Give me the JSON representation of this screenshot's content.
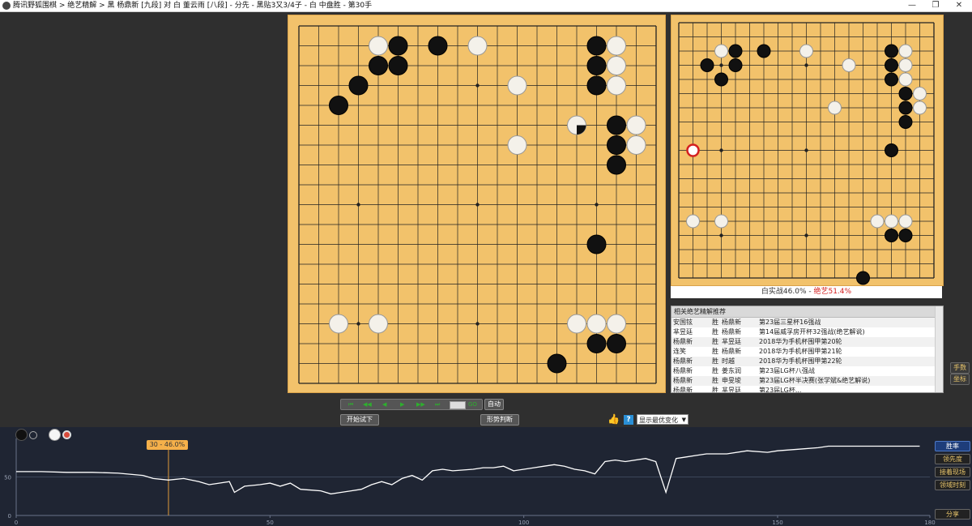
{
  "window": {
    "title": "腾讯野狐围棋 > 绝艺精解 > 黑 杨鼎新 [九段] 对 白 董云雨 [八段] - 分先 - 黑贴3又3/4子 - 白 中盘胜 - 第30手",
    "minimize": "—",
    "maximize": "❐",
    "close": "✕"
  },
  "main_board": {
    "size": 19,
    "black": [
      [
        4,
        2
      ],
      [
        5,
        1
      ],
      [
        5,
        2
      ],
      [
        7,
        1
      ],
      [
        3,
        3
      ],
      [
        2,
        4
      ],
      [
        15,
        1
      ],
      [
        15,
        2
      ],
      [
        15,
        3
      ],
      [
        16,
        5
      ],
      [
        16,
        6
      ],
      [
        16,
        7
      ],
      [
        15,
        11
      ],
      [
        15,
        16
      ],
      [
        16,
        16
      ],
      [
        13,
        17
      ]
    ],
    "white": [
      [
        4,
        1
      ],
      [
        9,
        1
      ],
      [
        11,
        3
      ],
      [
        16,
        1
      ],
      [
        16,
        2
      ],
      [
        16,
        3
      ],
      [
        17,
        5
      ],
      [
        17,
        6
      ],
      [
        11,
        6
      ],
      [
        2,
        15
      ],
      [
        4,
        15
      ],
      [
        14,
        15
      ],
      [
        15,
        15
      ],
      [
        16,
        15
      ]
    ],
    "last_move": [
      14,
      5
    ]
  },
  "side_board": {
    "size": 19,
    "black": [
      [
        2,
        3
      ],
      [
        3,
        4
      ],
      [
        4,
        2
      ],
      [
        4,
        3
      ],
      [
        6,
        2
      ],
      [
        13,
        18
      ],
      [
        15,
        2
      ],
      [
        15,
        3
      ],
      [
        15,
        4
      ],
      [
        16,
        5
      ],
      [
        16,
        6
      ],
      [
        16,
        7
      ],
      [
        15,
        9
      ],
      [
        15,
        15
      ],
      [
        16,
        15
      ]
    ],
    "white": [
      [
        3,
        2
      ],
      [
        9,
        2
      ],
      [
        12,
        3
      ],
      [
        16,
        2
      ],
      [
        16,
        3
      ],
      [
        16,
        4
      ],
      [
        17,
        5
      ],
      [
        17,
        6
      ],
      [
        11,
        6
      ],
      [
        1,
        14
      ],
      [
        3,
        14
      ],
      [
        14,
        14
      ],
      [
        15,
        14
      ],
      [
        16,
        14
      ]
    ],
    "marker": [
      1,
      9
    ]
  },
  "status": {
    "text": "白实战46.0% - ",
    "rate": "绝艺51.4%"
  },
  "gamelist": {
    "header": "相关绝艺精解推荐",
    "rows": [
      [
        "安国铉",
        "胜",
        "杨鼎新",
        "第23届三星杯16强战"
      ],
      [
        "芈昱廷",
        "胜",
        "杨鼎新",
        "第14届威孚房开杯32强战(绝艺解说)"
      ],
      [
        "杨鼎新",
        "胜",
        "芈昱廷",
        "2018华为手机杯围甲第20轮"
      ],
      [
        "连笑",
        "胜",
        "杨鼎新",
        "2018华为手机杯围甲第21轮"
      ],
      [
        "杨鼎新",
        "胜",
        "时越",
        "2018华为手机杯围甲第22轮"
      ],
      [
        "杨鼎新",
        "胜",
        "姜东润",
        "第23届LG杯八强战"
      ],
      [
        "杨鼎新",
        "胜",
        "申旻埈",
        "第23届LG杯半决赛(张学斌&绝艺解说)"
      ],
      [
        "杨鼎新",
        "胜",
        "芈昱廷",
        "第23届LG杯..."
      ]
    ]
  },
  "side_buttons": {
    "moves": "手数",
    "coords": "坐标"
  },
  "controls": {
    "first": "⏮",
    "back10": "◀◀",
    "back": "◀",
    "play": "▶",
    "fwd10": "▶▶",
    "last": "⏭",
    "go": "GO",
    "auto": "自动",
    "trial": "开始试下",
    "judge": "形势判断",
    "thumb": "👍",
    "help": "?",
    "select_value": "显示最优变化",
    "select_arrow": "▼"
  },
  "chart_panel": {
    "tooltip": "30 - 46.0%",
    "buttons": [
      "胜率",
      "领先度",
      "接着现场",
      "领域时刻"
    ],
    "share": "分享",
    "colors": {
      "line": "#ffffff",
      "cursor": "#e09a3a",
      "bg": "#1f2533"
    }
  },
  "chart_data": {
    "type": "line",
    "xlim": [
      0,
      180
    ],
    "ylim": [
      0,
      100
    ],
    "x_ticks": [
      "0",
      "50",
      "100",
      "150",
      "180"
    ],
    "y_ticks": [
      "50",
      "0"
    ],
    "cursor_x": 30,
    "series": [
      {
        "values": [
          [
            0,
            57
          ],
          [
            5,
            57
          ],
          [
            10,
            56
          ],
          [
            15,
            56
          ],
          [
            20,
            55
          ],
          [
            25,
            52
          ],
          [
            27,
            48
          ],
          [
            30,
            46
          ],
          [
            33,
            48
          ],
          [
            36,
            44
          ],
          [
            38,
            40
          ],
          [
            40,
            42
          ],
          [
            42,
            44
          ],
          [
            43,
            30
          ],
          [
            45,
            38
          ],
          [
            48,
            40
          ],
          [
            50,
            42
          ],
          [
            52,
            38
          ],
          [
            54,
            42
          ],
          [
            56,
            34
          ],
          [
            60,
            32
          ],
          [
            62,
            28
          ],
          [
            64,
            30
          ],
          [
            66,
            32
          ],
          [
            68,
            34
          ],
          [
            70,
            40
          ],
          [
            72,
            44
          ],
          [
            74,
            40
          ],
          [
            76,
            48
          ],
          [
            78,
            52
          ],
          [
            80,
            46
          ],
          [
            82,
            58
          ],
          [
            84,
            60
          ],
          [
            86,
            58
          ],
          [
            90,
            60
          ],
          [
            92,
            62
          ],
          [
            94,
            62
          ],
          [
            96,
            64
          ],
          [
            98,
            58
          ],
          [
            100,
            60
          ],
          [
            102,
            62
          ],
          [
            104,
            64
          ],
          [
            106,
            66
          ],
          [
            108,
            64
          ],
          [
            110,
            60
          ],
          [
            112,
            58
          ],
          [
            114,
            54
          ],
          [
            116,
            70
          ],
          [
            118,
            72
          ],
          [
            120,
            70
          ],
          [
            124,
            74
          ],
          [
            126,
            70
          ],
          [
            128,
            30
          ],
          [
            130,
            74
          ],
          [
            132,
            76
          ],
          [
            134,
            78
          ],
          [
            136,
            80
          ],
          [
            140,
            80
          ],
          [
            144,
            84
          ],
          [
            148,
            82
          ],
          [
            150,
            84
          ],
          [
            154,
            86
          ],
          [
            158,
            88
          ],
          [
            160,
            90
          ],
          [
            170,
            90
          ],
          [
            178,
            90
          ]
        ]
      }
    ]
  }
}
